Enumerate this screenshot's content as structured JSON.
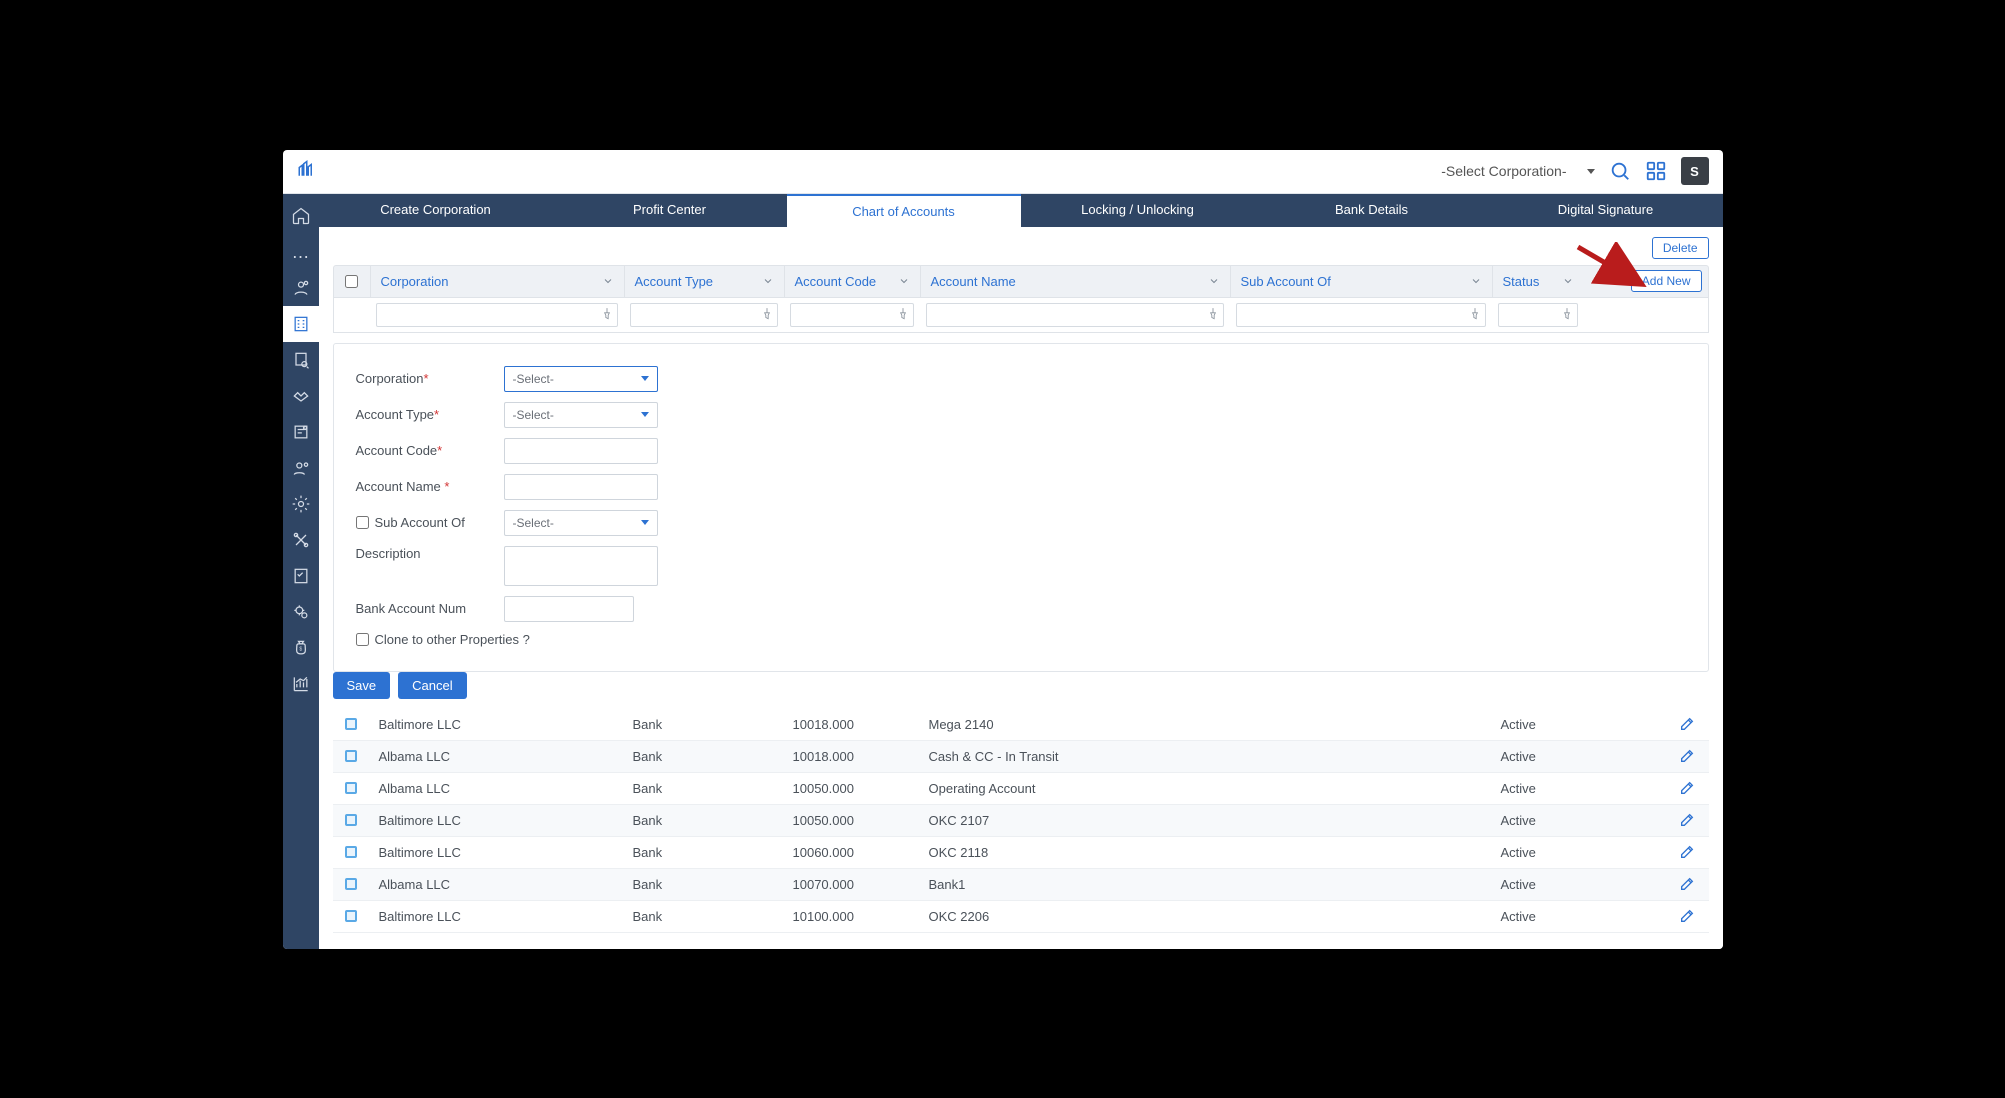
{
  "topbar": {
    "corp_select_label": "-Select Corporation-",
    "avatar_initial": "S"
  },
  "tabs": [
    {
      "label": "Create Corporation"
    },
    {
      "label": "Profit Center"
    },
    {
      "label": "Chart of Accounts"
    },
    {
      "label": "Locking / Unlocking"
    },
    {
      "label": "Bank Details"
    },
    {
      "label": "Digital Signature"
    }
  ],
  "actions": {
    "delete_label": "Delete",
    "add_new_label": "Add New"
  },
  "grid_headers": {
    "corporation": "Corporation",
    "account_type": "Account Type",
    "account_code": "Account Code",
    "account_name": "Account Name",
    "sub_account_of": "Sub Account Of",
    "status": "Status"
  },
  "form": {
    "labels": {
      "corporation": "Corporation",
      "account_type": "Account Type",
      "account_code": "Account Code",
      "account_name": "Account Name",
      "sub_account_of": "Sub Account Of",
      "description": "Description",
      "bank_account_num": "Bank Account Num",
      "clone": "Clone to other Properties ?"
    },
    "select_placeholder": "-Select-",
    "save_label": "Save",
    "cancel_label": "Cancel"
  },
  "rows": [
    {
      "corp": "Baltimore LLC",
      "type": "Bank",
      "code": "10018.000",
      "name": "Mega 2140",
      "sub": "",
      "status": "Active"
    },
    {
      "corp": "Albama LLC",
      "type": "Bank",
      "code": "10018.000",
      "name": "Cash & CC - In Transit",
      "sub": "",
      "status": "Active"
    },
    {
      "corp": "Albama LLC",
      "type": "Bank",
      "code": "10050.000",
      "name": "Operating Account",
      "sub": "",
      "status": "Active"
    },
    {
      "corp": "Baltimore LLC",
      "type": "Bank",
      "code": "10050.000",
      "name": "OKC 2107",
      "sub": "",
      "status": "Active"
    },
    {
      "corp": "Baltimore LLC",
      "type": "Bank",
      "code": "10060.000",
      "name": "OKC 2118",
      "sub": "",
      "status": "Active"
    },
    {
      "corp": "Albama LLC",
      "type": "Bank",
      "code": "10070.000",
      "name": "Bank1",
      "sub": "",
      "status": "Active"
    },
    {
      "corp": "Baltimore LLC",
      "type": "Bank",
      "code": "10100.000",
      "name": "OKC 2206",
      "sub": "",
      "status": "Active"
    }
  ]
}
